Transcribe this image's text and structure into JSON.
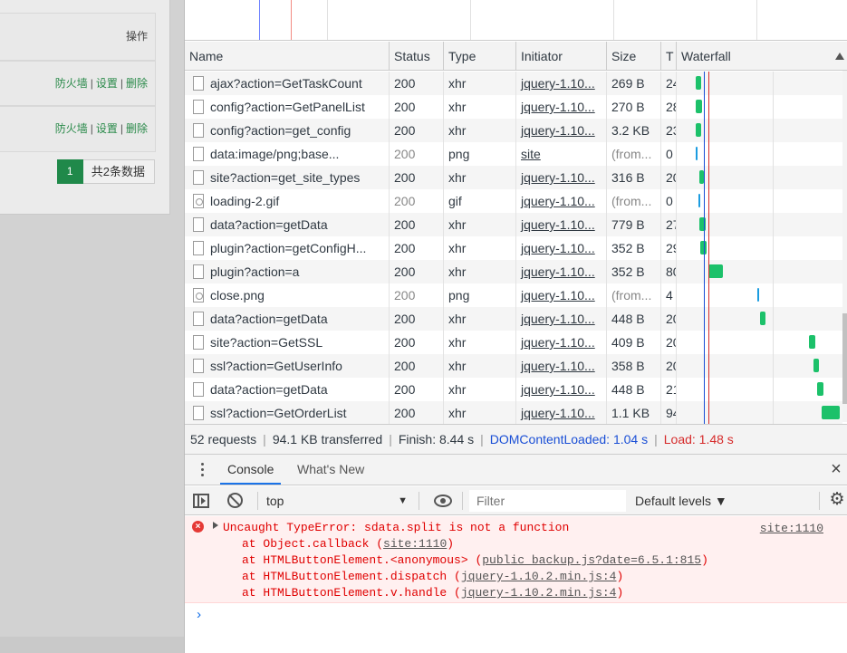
{
  "left_page": {
    "header_label": "操作",
    "rows": [
      {
        "firewall": "防火墙",
        "settings": "设置",
        "delete": "删除",
        "sep": "|"
      },
      {
        "firewall": "防火墙",
        "settings": "设置",
        "delete": "删除",
        "sep": "|"
      }
    ],
    "pager": {
      "current_page": "1",
      "total_label": "共2条数据"
    }
  },
  "network": {
    "columns": {
      "name": "Name",
      "status": "Status",
      "type": "Type",
      "initiator": "Initiator",
      "size": "Size",
      "time": "T",
      "waterfall": "Waterfall"
    },
    "rows": [
      {
        "name": "ajax?action=GetTaskCount",
        "status": "200",
        "type": "xhr",
        "initiator": "jquery-1.10...",
        "size": "269 B",
        "time": "24",
        "icon": "file-icon"
      },
      {
        "name": "config?action=GetPanelList",
        "status": "200",
        "type": "xhr",
        "initiator": "jquery-1.10...",
        "size": "270 B",
        "time": "28",
        "icon": "file-icon"
      },
      {
        "name": "config?action=get_config",
        "status": "200",
        "type": "xhr",
        "initiator": "jquery-1.10...",
        "size": "3.2 KB",
        "time": "23",
        "icon": "file-icon"
      },
      {
        "name": "data:image/png;base...",
        "status": "200",
        "type": "png",
        "initiator": "site",
        "size": "(from...",
        "time": "0",
        "icon": "file-icon"
      },
      {
        "name": "site?action=get_site_types",
        "status": "200",
        "type": "xhr",
        "initiator": "jquery-1.10...",
        "size": "316 B",
        "time": "20",
        "icon": "file-icon"
      },
      {
        "name": "loading-2.gif",
        "status": "200",
        "type": "gif",
        "initiator": "jquery-1.10...",
        "size": "(from...",
        "time": "0",
        "icon": "image-file-icon"
      },
      {
        "name": "data?action=getData",
        "status": "200",
        "type": "xhr",
        "initiator": "jquery-1.10...",
        "size": "779 B",
        "time": "27",
        "icon": "file-icon"
      },
      {
        "name": "plugin?action=getConfigH...",
        "status": "200",
        "type": "xhr",
        "initiator": "jquery-1.10...",
        "size": "352 B",
        "time": "29",
        "icon": "file-icon"
      },
      {
        "name": "plugin?action=a",
        "status": "200",
        "type": "xhr",
        "initiator": "jquery-1.10...",
        "size": "352 B",
        "time": "80",
        "icon": "file-icon"
      },
      {
        "name": "close.png",
        "status": "200",
        "type": "png",
        "initiator": "jquery-1.10...",
        "size": "(from...",
        "time": "4",
        "icon": "image-file-icon"
      },
      {
        "name": "data?action=getData",
        "status": "200",
        "type": "xhr",
        "initiator": "jquery-1.10...",
        "size": "448 B",
        "time": "20",
        "icon": "file-icon"
      },
      {
        "name": "site?action=GetSSL",
        "status": "200",
        "type": "xhr",
        "initiator": "jquery-1.10...",
        "size": "409 B",
        "time": "20",
        "icon": "file-icon"
      },
      {
        "name": "ssl?action=GetUserInfo",
        "status": "200",
        "type": "xhr",
        "initiator": "jquery-1.10...",
        "size": "358 B",
        "time": "20",
        "icon": "file-icon"
      },
      {
        "name": "data?action=getData",
        "status": "200",
        "type": "xhr",
        "initiator": "jquery-1.10...",
        "size": "448 B",
        "time": "21",
        "icon": "file-icon"
      },
      {
        "name": "ssl?action=GetOrderList",
        "status": "200",
        "type": "xhr",
        "initiator": "jquery-1.10...",
        "size": "1.1 KB",
        "time": "94",
        "icon": "file-icon"
      }
    ],
    "summary": {
      "requests": "52 requests",
      "transferred": "94.1 KB transferred",
      "finish": "Finish: 8.44 s",
      "dom_content_loaded": "DOMContentLoaded: 1.04 s",
      "load": "Load: 1.48 s",
      "sep": "|"
    },
    "colors": {
      "xhr_bar": "#1cc16a",
      "download_bar": "#1b9ce0",
      "dom_line": "#1a4fd6",
      "load_line": "#d62b2b"
    }
  },
  "drawer": {
    "tabs": [
      "Console",
      "What's New"
    ],
    "active_tab": "Console"
  },
  "console_toolbar": {
    "context": "top",
    "filter_placeholder": "Filter",
    "levels": "Default levels ▼"
  },
  "console": {
    "error": {
      "message": "Uncaught TypeError: sdata.split is not a function",
      "source": "site:1110",
      "stack": [
        {
          "prefix": "at Object.callback (",
          "link": "site:1110",
          "suffix": ")"
        },
        {
          "prefix": "at HTMLButtonElement.<anonymous> (",
          "link": "public_backup.js?date=6.5.1:815",
          "suffix": ")"
        },
        {
          "prefix": "at HTMLButtonElement.dispatch (",
          "link": "jquery-1.10.2.min.js:4",
          "suffix": ")"
        },
        {
          "prefix": "at HTMLButtonElement.v.handle (",
          "link": "jquery-1.10.2.min.js:4",
          "suffix": ")"
        }
      ]
    },
    "prompt": "›"
  }
}
